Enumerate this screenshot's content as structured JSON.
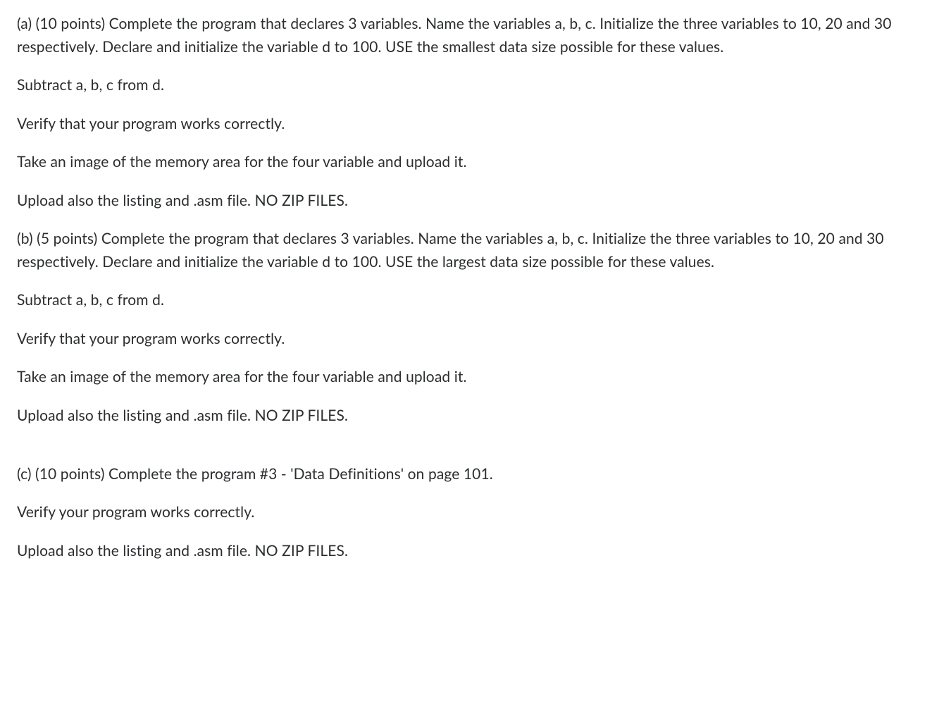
{
  "paragraphs": [
    "(a) (10 points) Complete the program that declares 3 variables. Name the variables a, b, c. Initialize the three variables to 10, 20 and 30 respectively. Declare and initialize the variable d to 100. USE the smallest data size possible for these values.",
    "Subtract a, b, c from d.",
    "Verify that your program works correctly.",
    "Take an image of the memory area for the four variable and upload it.",
    "Upload also the listing and .asm file. NO ZIP FILES.",
    "(b) (5 points) Complete the program that declares 3 variables. Name the variables a, b, c. Initialize the three variables to 10, 20 and 30 respectively. Declare and initialize the variable d to 100. USE the largest data size possible for these values.",
    "Subtract a, b, c from d.",
    "Verify that your program works correctly.",
    "Take an image of the memory area for the four variable and upload it.",
    "Upload also the listing and .asm file. NO ZIP FILES.",
    "(c) (10 points)  Complete the program #3 - 'Data Definitions' on page 101.",
    "Verify your program works correctly.",
    "Upload also the listing and .asm file. NO ZIP FILES."
  ]
}
